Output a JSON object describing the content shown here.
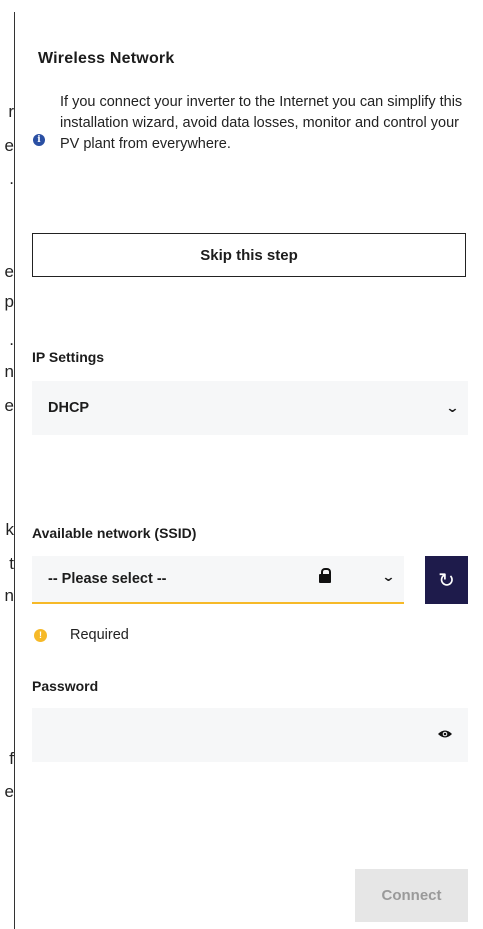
{
  "background_fragments": [
    "r",
    "e",
    ".",
    "e",
    "p",
    ".",
    "n",
    "e",
    "k",
    "t",
    "n",
    "f",
    "e"
  ],
  "wireless": {
    "title": "Wireless Network",
    "info_icon": "info-icon",
    "info_text": "If you connect your inverter to the Internet you can simplify this installation wizard, avoid data losses, monitor and control your PV plant from everywhere.",
    "skip_label": "Skip this step"
  },
  "ip_settings": {
    "label": "IP Settings",
    "selected": "DHCP",
    "chevron": "chevron-down-icon"
  },
  "ssid": {
    "label": "Available network (SSID)",
    "selected": "-- Please select --",
    "lock_icon": "lock-icon",
    "chevron": "chevron-down-icon",
    "refresh_icon": "refresh-icon",
    "required_text": "Required",
    "accent_color": "#f6b928"
  },
  "password": {
    "label": "Password",
    "value": "",
    "eye_icon": "eye-icon"
  },
  "connect_label": "Connect",
  "colors": {
    "refresh_button": "#1e1b4b",
    "info_icon": "#2a4fa3",
    "warning": "#f6b928",
    "disabled_button": "#e6e6e6"
  }
}
